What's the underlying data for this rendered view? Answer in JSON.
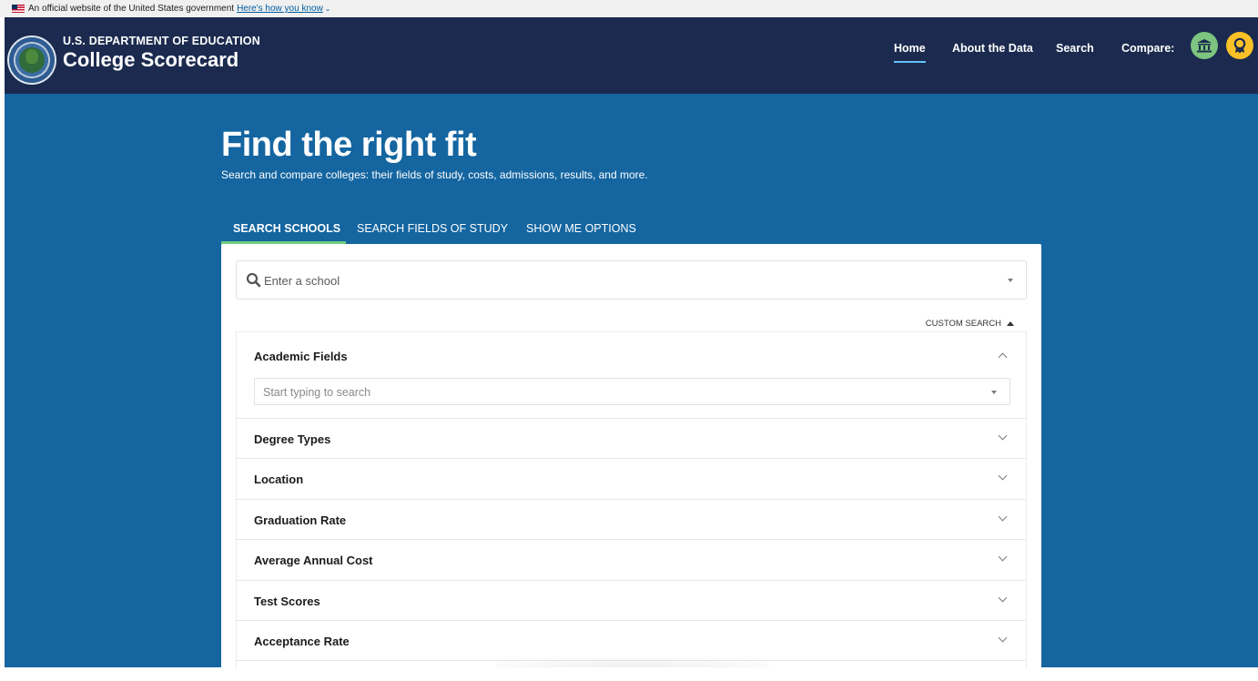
{
  "gov_banner": {
    "text": "An official website of the United States government",
    "link": "Here's how you know"
  },
  "header": {
    "agency": "U.S. DEPARTMENT OF EDUCATION",
    "site_title": "College Scorecard",
    "nav": {
      "home": "Home",
      "about": "About the Data",
      "search": "Search",
      "compare": "Compare:"
    }
  },
  "hero": {
    "title": "Find the right fit",
    "subtitle": "Search and compare colleges: their fields of study, costs, admissions, results, and more."
  },
  "tabs": [
    "SEARCH SCHOOLS",
    "SEARCH FIELDS OF STUDY",
    "SHOW ME OPTIONS"
  ],
  "search": {
    "placeholder": "Enter a school",
    "custom_search": "CUSTOM SEARCH"
  },
  "filters": {
    "academic_fields": {
      "label": "Academic Fields",
      "placeholder": "Start typing to search"
    },
    "items": [
      "Degree Types",
      "Location",
      "Graduation Rate",
      "Average Annual Cost",
      "Test Scores",
      "Acceptance Rate"
    ]
  },
  "colors": {
    "header_bg": "#1b2a4e",
    "hero_bg": "#1465a0",
    "active_tab": "#6fcf7d",
    "compare_school": "#7cc47f",
    "compare_field": "#f7c127"
  },
  "icons": [
    "us-flag-icon",
    "chevron-down-icon",
    "school-compare-icon",
    "field-compare-icon",
    "search-icon",
    "caret-down-icon",
    "caret-up-icon",
    "chevron-up-icon"
  ]
}
